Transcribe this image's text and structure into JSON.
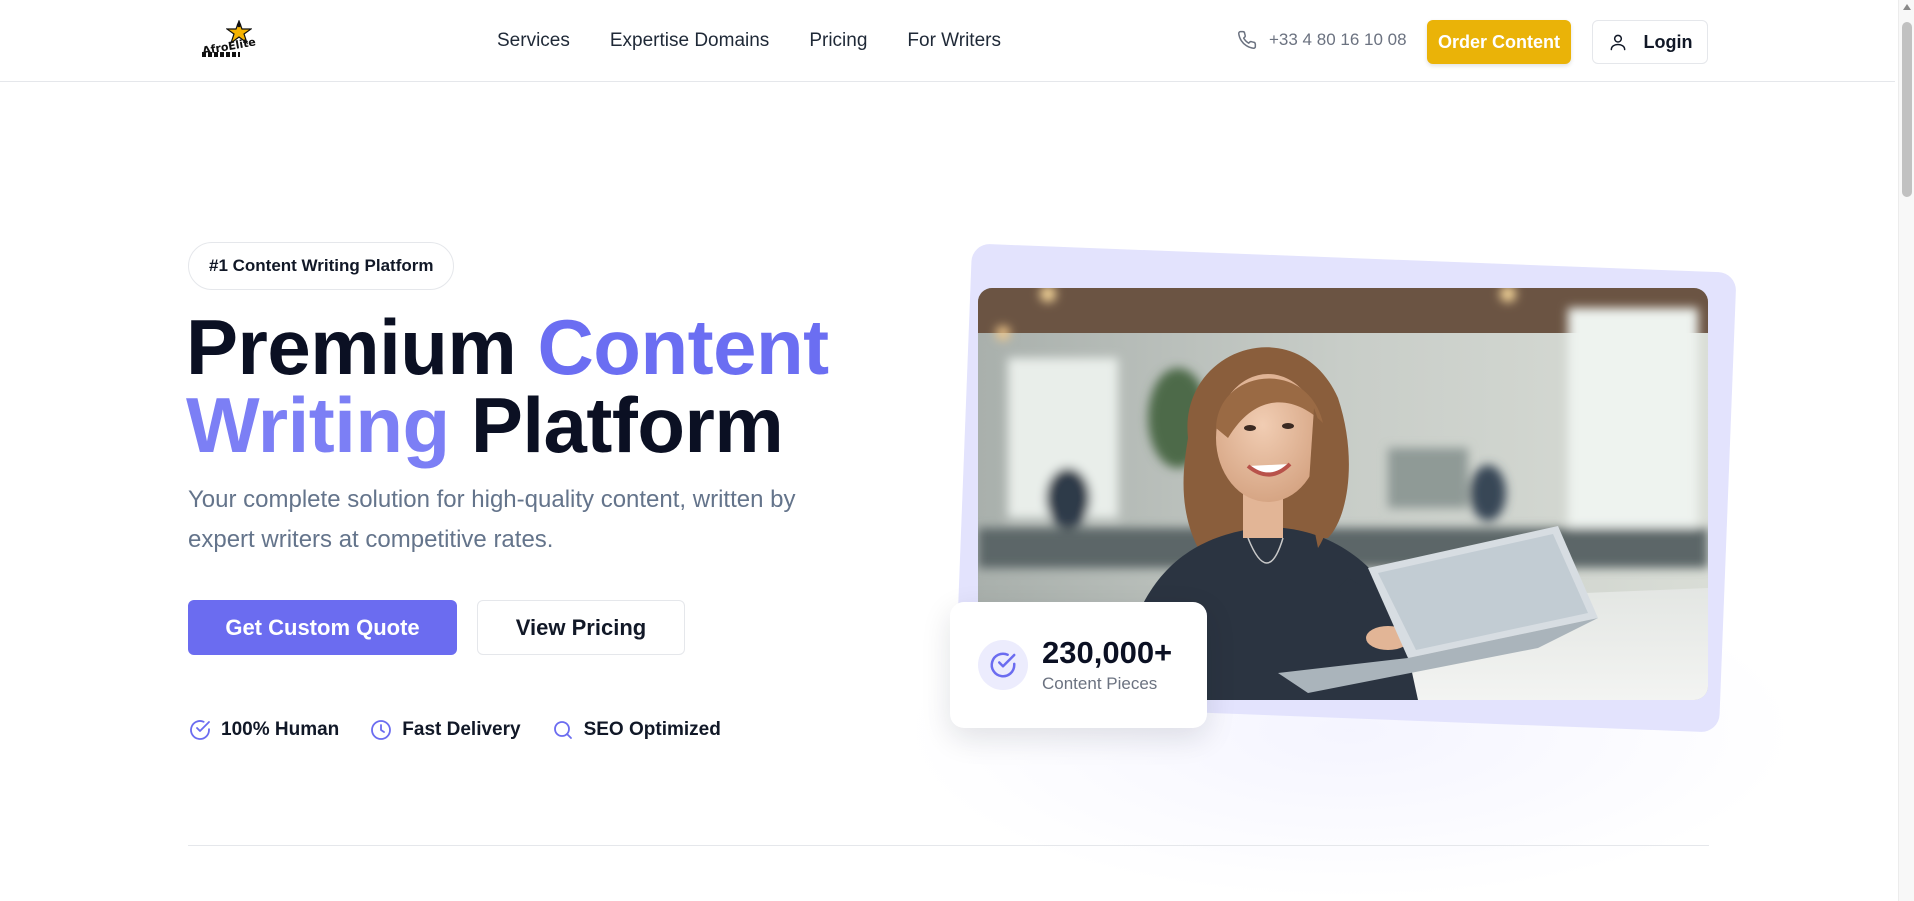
{
  "brand": {
    "logo_text": "AfroElite"
  },
  "nav": {
    "items": [
      {
        "label": "Services"
      },
      {
        "label": "Expertise Domains"
      },
      {
        "label": "Pricing"
      },
      {
        "label": "For Writers"
      }
    ],
    "phone": "+33 4 80 16 10 08",
    "order_label": "Order Content",
    "login_label": "Login"
  },
  "hero": {
    "badge": "#1 Content Writing Platform",
    "headline": {
      "part1": "Premium ",
      "part2": "Content",
      "part3": "Writing",
      "part4": " Platform"
    },
    "subtitle": "Your complete solution for high-quality content, written by expert writers at competitive rates.",
    "primary_cta": "Get Custom Quote",
    "secondary_cta": "View Pricing",
    "features": [
      {
        "label": "100% Human",
        "icon": "check-circle-icon"
      },
      {
        "label": "Fast Delivery",
        "icon": "clock-icon"
      },
      {
        "label": "SEO Optimized",
        "icon": "search-icon"
      }
    ],
    "stat": {
      "value": "230,000+",
      "label": "Content Pieces",
      "icon": "check-circle-icon"
    }
  },
  "colors": {
    "accent": "#6b6cf0",
    "order_button": "#eab308",
    "heading": "#0b1023",
    "muted": "#64748b"
  }
}
